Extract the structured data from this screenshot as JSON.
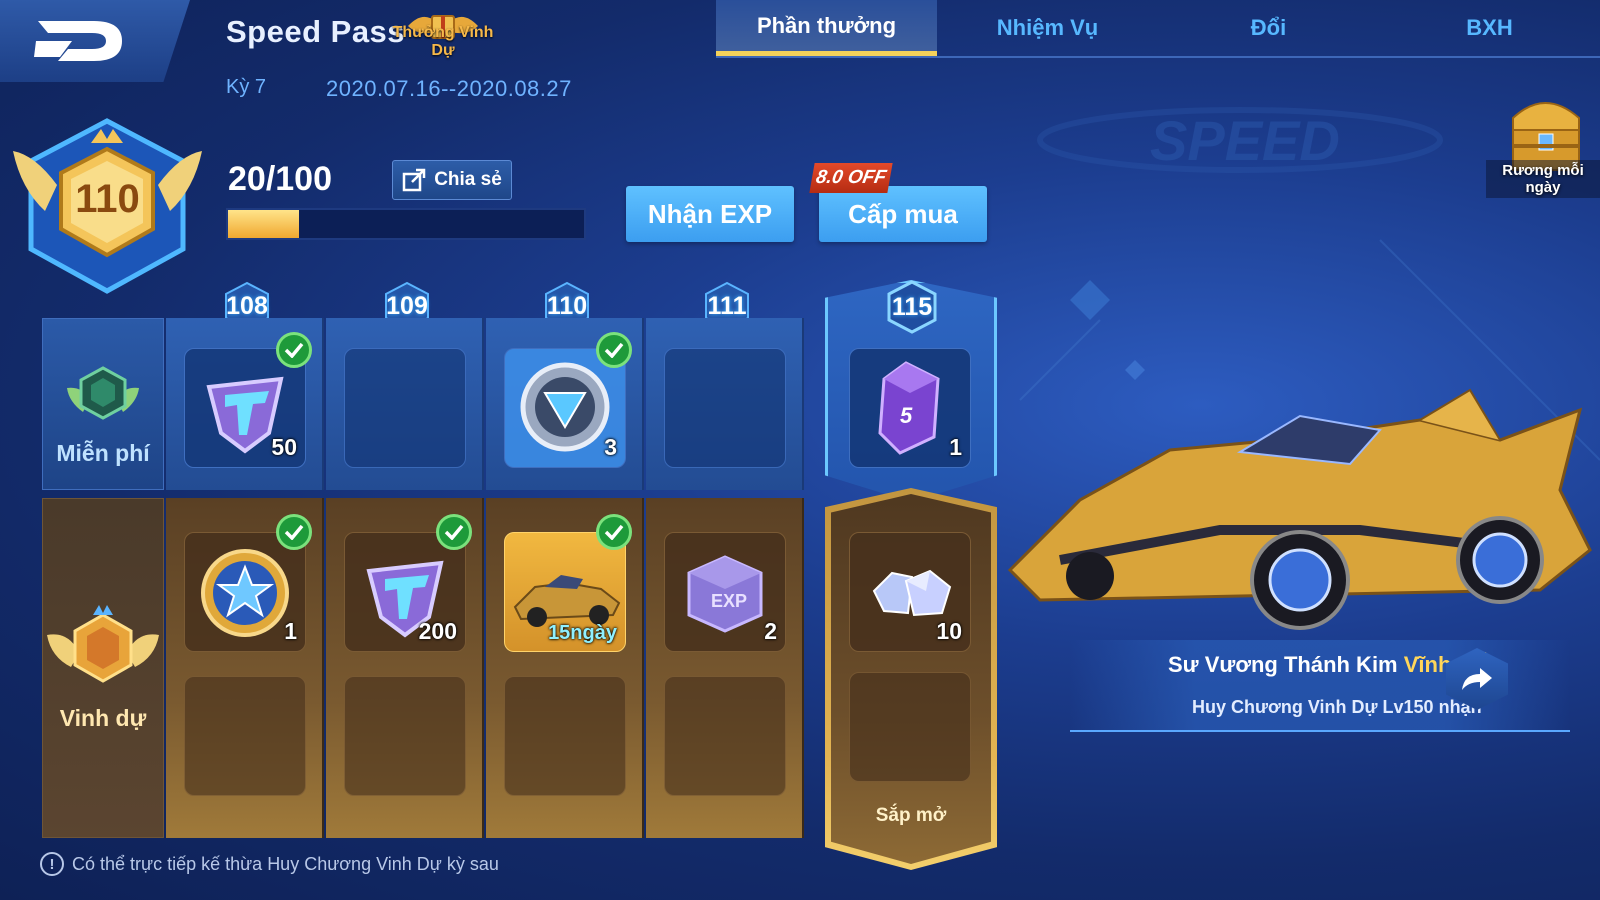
{
  "header": {
    "title": "Speed Pass",
    "honor_badge_label": "Thưởng Vinh Dự",
    "season_label": "Kỳ 7",
    "date_range": "2020.07.16--2020.08.27"
  },
  "tabs": [
    {
      "label": "Phần thưởng",
      "active": true
    },
    {
      "label": "Nhiệm Vụ",
      "active": false
    },
    {
      "label": "Đổi",
      "active": false
    },
    {
      "label": "BXH",
      "active": false
    }
  ],
  "daily_chest": {
    "label": "Rương mỗi ngày"
  },
  "level": {
    "current": "110",
    "progress_text": "20/100",
    "progress_fraction": 0.2
  },
  "buttons": {
    "share": "Chia sẻ",
    "get_exp": "Nhận EXP",
    "buy_level": "Cấp mua",
    "discount": "8.0 OFF"
  },
  "rows": {
    "free": "Miễn phí",
    "honor": "Vinh dự"
  },
  "columns": [
    {
      "level": "108",
      "free": {
        "item": "t-coin-icon",
        "qty": "50",
        "claimed": true
      },
      "honor": {
        "item": "star-medal-icon",
        "qty": "1",
        "claimed": true
      }
    },
    {
      "level": "109",
      "free": null,
      "honor": {
        "item": "t-coin-icon",
        "qty": "200",
        "claimed": true
      }
    },
    {
      "level": "110",
      "free": {
        "item": "shield-token-icon",
        "qty": "3",
        "claimed": true
      },
      "honor": {
        "item": "car-icon",
        "qty": "15ngày",
        "claimed": true
      }
    },
    {
      "level": "111",
      "free": null,
      "honor": {
        "item": "exp-cube-icon",
        "qty": "2",
        "claimed": false
      }
    },
    {
      "level": "115",
      "free": {
        "item": "purple-gem-icon",
        "qty": "1",
        "claimed": false
      },
      "honor": {
        "item": "diamond-icon",
        "qty": "10",
        "claimed": false
      },
      "status": "Sắp mở"
    }
  ],
  "featured_car": {
    "name_prefix": "Sư Vương Thánh Kim",
    "name_highlight": "Vĩnh viễn",
    "subtitle": "Huy Chương Vinh Dự Lv150 nhận"
  },
  "footer_note": "Có thể trực tiếp kế thừa Huy Chương Vinh Dự kỳ sau",
  "colors": {
    "accent_gold": "#f4d25a",
    "tab_text": "#57b8ff",
    "check_green": "#1e9a3a"
  }
}
